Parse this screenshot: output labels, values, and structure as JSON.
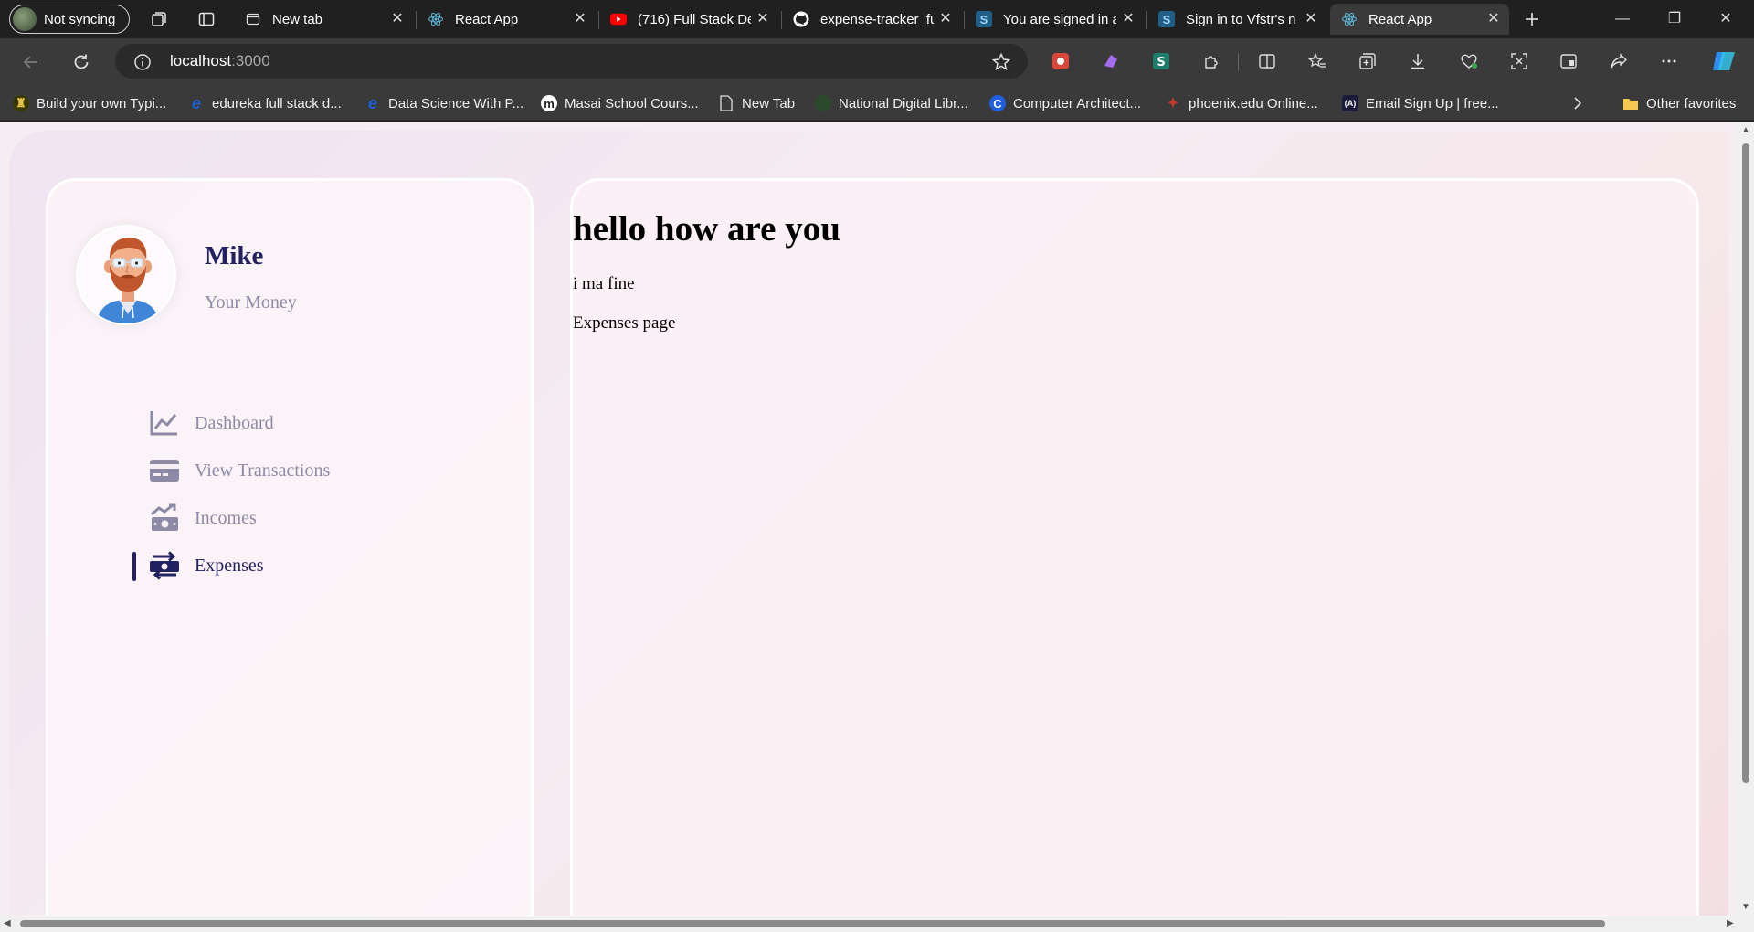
{
  "browser": {
    "profile_label": "Not syncing",
    "tabs": [
      {
        "label": "New tab",
        "icon": "new-tab-icon"
      },
      {
        "label": "React App",
        "icon": "react-icon"
      },
      {
        "label": "(716) Full Stack De",
        "icon": "youtube-icon"
      },
      {
        "label": "expense-tracker_fu",
        "icon": "github-icon"
      },
      {
        "label": "You are signed in a",
        "icon": "s-icon"
      },
      {
        "label": "Sign in to Vfstr's n",
        "icon": "s-icon"
      },
      {
        "label": "React App",
        "icon": "react-icon"
      }
    ],
    "url_host": "localhost",
    "url_port": ":3000",
    "bookmarks": [
      {
        "label": "Build your own Typi...",
        "icon": "vfstr-icon"
      },
      {
        "label": "edureka full stack d...",
        "icon": "edureka-icon"
      },
      {
        "label": "Data Science With P...",
        "icon": "edureka-icon"
      },
      {
        "label": "Masai School Cours...",
        "icon": "masai-icon"
      },
      {
        "label": "New Tab",
        "icon": "page-icon"
      },
      {
        "label": "National Digital Libr...",
        "icon": "ndl-icon"
      },
      {
        "label": "Computer Architect...",
        "icon": "c-icon"
      },
      {
        "label": "phoenix.edu Online...",
        "icon": "phoenix-icon"
      },
      {
        "label": "Email Sign Up | free...",
        "icon": "code-icon"
      }
    ],
    "other_favorites": "Other favorites"
  },
  "sidebar": {
    "user_name": "Mike",
    "user_sub": "Your Money",
    "menu": [
      {
        "label": "Dashboard",
        "icon": "chart-line-icon",
        "active": false
      },
      {
        "label": "View Transactions",
        "icon": "credit-card-icon",
        "active": false
      },
      {
        "label": "Incomes",
        "icon": "money-trend-icon",
        "active": false
      },
      {
        "label": "Expenses",
        "icon": "money-exchange-icon",
        "active": true
      }
    ]
  },
  "main": {
    "heading": "hello how are you",
    "para1": "i ma fine",
    "para2": "Expenses page"
  },
  "colors": {
    "brand_dark": "#222260",
    "muted": "#8c8aa6",
    "browser_bg": "#202020",
    "toolbar_bg": "#3a3a3a"
  }
}
